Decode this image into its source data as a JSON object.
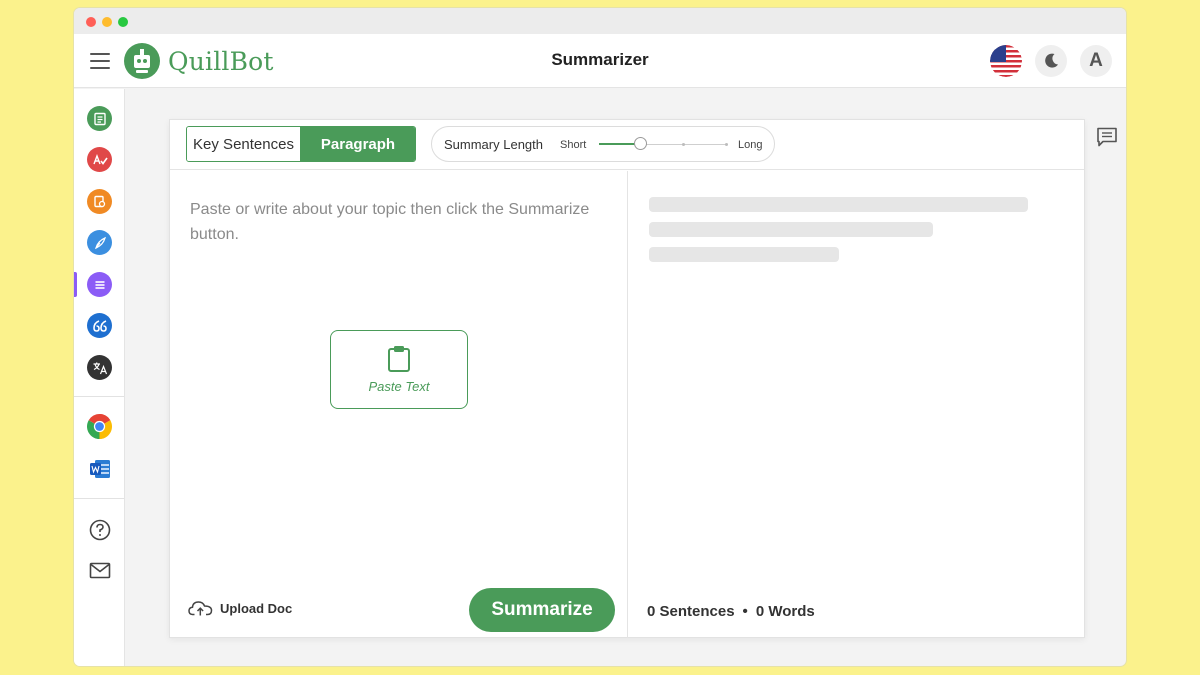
{
  "header": {
    "brand": "QuillBot",
    "title": "Summarizer",
    "avatar_letter": "A"
  },
  "sidebar": {
    "items": [
      {
        "name": "paraphraser",
        "color": "#4a9b59"
      },
      {
        "name": "grammar-checker",
        "color": "#e04848"
      },
      {
        "name": "plagiarism-checker",
        "color": "#f08a24"
      },
      {
        "name": "co-writer",
        "color": "#3b8fe0"
      },
      {
        "name": "summarizer",
        "color": "#8b5cf6"
      },
      {
        "name": "citation-generator",
        "color": "#1e6fd0"
      },
      {
        "name": "translator",
        "color": "#333333"
      },
      {
        "name": "chrome-extension"
      },
      {
        "name": "word-add-in"
      },
      {
        "name": "help"
      },
      {
        "name": "contact"
      }
    ]
  },
  "modes": {
    "key_sentences": "Key Sentences",
    "paragraph": "Paragraph",
    "active": "paragraph"
  },
  "summary_length": {
    "label": "Summary Length",
    "short": "Short",
    "long": "Long",
    "value_fraction": 0.33
  },
  "input": {
    "placeholder": "Paste or write about your topic then click the Summarize button.",
    "value": ""
  },
  "paste_button": {
    "label": "Paste Text"
  },
  "upload": {
    "label": "Upload Doc"
  },
  "summarize_button": {
    "label": "Summarize"
  },
  "stats": {
    "sentences": "0 Sentences",
    "separator": "•",
    "words": "0 Words"
  },
  "colors": {
    "brand_green": "#4a9b59",
    "background": "#fbf28c"
  }
}
